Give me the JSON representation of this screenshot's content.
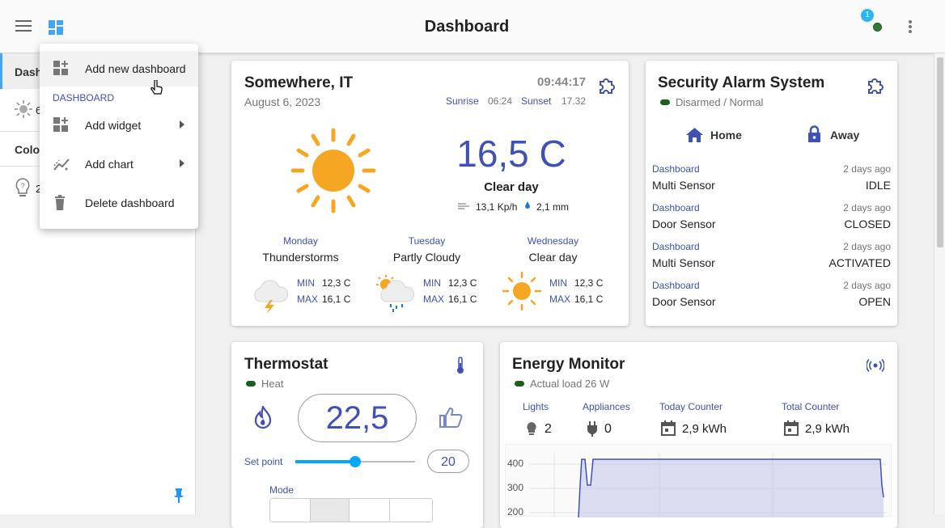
{
  "header": {
    "title": "Dashboard",
    "notification_count": "1"
  },
  "sidebar": {
    "item1_label": "Dash",
    "item2_label": "6",
    "section_label": "Color",
    "item3_label": "2"
  },
  "menu": {
    "add_dashboard": "Add new dashboard",
    "section": "DASHBOARD",
    "add_widget": "Add widget",
    "add_chart": "Add chart",
    "delete_dashboard": "Delete dashboard"
  },
  "weather": {
    "location": "Somewhere, IT",
    "date": "August 6, 2023",
    "time": "09:44:17",
    "sunrise_label": "Sunrise",
    "sunrise": "06:24",
    "sunset_label": "Sunset",
    "sunset": "17.32",
    "temperature": "16,5 C",
    "condition": "Clear day",
    "wind": "13,1 Kp/h",
    "rain": "2,1 mm",
    "forecast": [
      {
        "day": "Monday",
        "condition": "Thunderstorms",
        "min_label": "MIN",
        "min": "12,3 C",
        "max_label": "MAX",
        "max": "16,1 C"
      },
      {
        "day": "Tuesday",
        "condition": "Partly Cloudy",
        "min_label": "MIN",
        "min": "12,3 C",
        "max_label": "MAX",
        "max": "16,1 C"
      },
      {
        "day": "Wednesday",
        "condition": "Clear day",
        "min_label": "MIN",
        "min": "12,3 C",
        "max_label": "MAX",
        "max": "16,1 C"
      }
    ]
  },
  "security": {
    "title": "Security Alarm System",
    "status": "Disarmed / Normal",
    "home_label": "Home",
    "away_label": "Away",
    "events": [
      {
        "source": "Dashboard",
        "time": "2 days ago",
        "name": "Multi Sensor",
        "state": "IDLE"
      },
      {
        "source": "Dashboard",
        "time": "2 days ago",
        "name": "Door Sensor",
        "state": "CLOSED"
      },
      {
        "source": "Dashboard",
        "time": "2 days ago",
        "name": "Multi Sensor",
        "state": "ACTIVATED"
      },
      {
        "source": "Dashboard",
        "time": "2 days ago",
        "name": "Door Sensor",
        "state": "OPEN"
      }
    ]
  },
  "thermostat": {
    "title": "Thermostat",
    "status": "Heat",
    "temperature": "22,5",
    "setpoint_label": "Set point",
    "setpoint": "20",
    "setpoint_slider_fraction": 0.5,
    "mode_label": "Mode"
  },
  "energy": {
    "title": "Energy Monitor",
    "status": "Actual load 26 W",
    "lights_label": "Lights",
    "lights": "2",
    "appliances_label": "Appliances",
    "appliances": "0",
    "today_label": "Today Counter",
    "today": "2,9 kWh",
    "total_label": "Total Counter",
    "total": "2,9 kWh",
    "chart_ticks": [
      "400",
      "300",
      "200"
    ]
  },
  "colors": {
    "accent": "#3f51b5",
    "sun": "#f5a623",
    "status_green": "#1b5e20",
    "slider": "#03a9f4"
  }
}
